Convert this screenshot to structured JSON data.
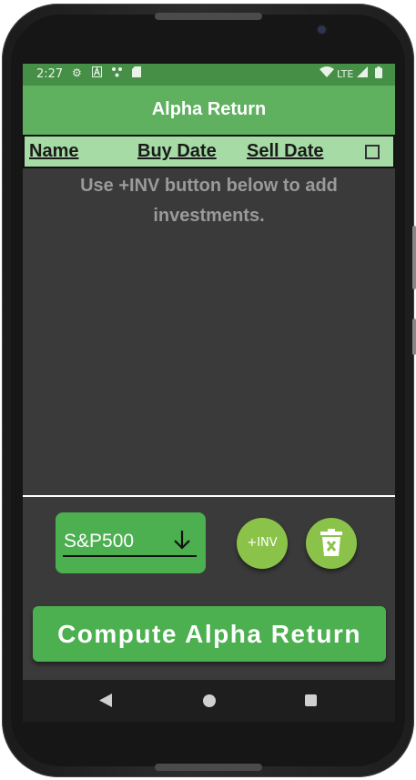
{
  "status_bar": {
    "time": "2:27",
    "left_icons": [
      "settings-icon",
      "a-icon",
      "dots-icon",
      "sd-card-icon"
    ],
    "network": "LTE",
    "right_icons": [
      "wifi-icon",
      "signal-icon",
      "battery-icon"
    ]
  },
  "app_bar": {
    "title": "Alpha Return"
  },
  "table_header": {
    "name": "Name",
    "buy_date": "Buy Date",
    "sell_date": "Sell Date",
    "select_all_checked": false
  },
  "empty_message": "Use +INV button below to add investments.",
  "index_selector": {
    "value": "S&P500",
    "icon": "arrow-down-icon"
  },
  "add_investment_button": {
    "label": "+INV"
  },
  "delete_button": {
    "icon": "trash-icon"
  },
  "compute_button": {
    "label": "Compute Alpha Return"
  },
  "nav_bar": {
    "icons": [
      "back-icon",
      "home-icon",
      "recents-icon"
    ]
  },
  "colors": {
    "status_bar": "#468f47",
    "app_bar": "#5fb05f",
    "header_row": "#a6dba6",
    "background": "#3a3a3a",
    "primary_button": "#4caf50",
    "fab": "#8bc34a"
  }
}
